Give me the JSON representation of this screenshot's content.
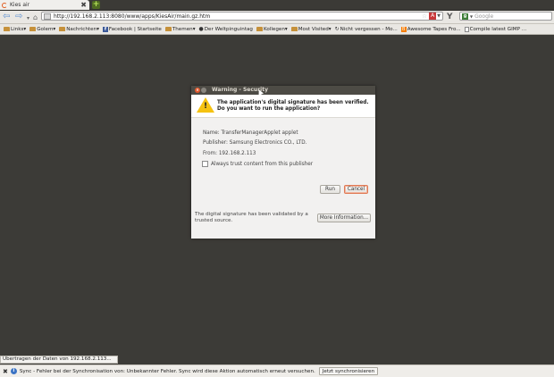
{
  "tab": {
    "title": "Kies air",
    "close_glyph": "✖"
  },
  "new_tab_glyph": "+",
  "nav": {
    "back_glyph": "⇦",
    "forward_glyph": "⇨",
    "dropdown_glyph": "▾",
    "home_glyph": "⌂",
    "url": "http://192.168.2.113:8080/www/apps/KiesAir/main.gz.htm",
    "star_glyph": "☆",
    "red_icon_glyph": "A",
    "url_dropdown_glyph": "▼",
    "twitter_glyph": "Y",
    "search_engine_glyph": "g",
    "search_dropdown_glyph": "▼",
    "search_placeholder": "Google"
  },
  "bookmarks": [
    {
      "label": "Links",
      "kind": "folder"
    },
    {
      "label": "Golem",
      "kind": "folder"
    },
    {
      "label": "Nachrichten",
      "kind": "folder"
    },
    {
      "label": "Facebook | Startseite",
      "kind": "facebook"
    },
    {
      "label": "Themen",
      "kind": "folder"
    },
    {
      "label": "Der Weltpinguintag",
      "kind": "penguin"
    },
    {
      "label": "Kollegen",
      "kind": "folder"
    },
    {
      "label": "Most Visited",
      "kind": "folder"
    },
    {
      "label": "Nicht vergessen - Mo...",
      "kind": "refresh"
    },
    {
      "label": "Awesome Tapes Fro...",
      "kind": "blogger"
    },
    {
      "label": "Compile latest GIMP ...",
      "kind": "page"
    }
  ],
  "bookmark_arrow": "▾",
  "dialog": {
    "title": "Warning - Security",
    "close_glyph": "×",
    "warning_glyph": "!",
    "heading": "The application's digital signature has been verified. Do you want to run the application?",
    "name_line": "Name:  TransferManagerApplet applet",
    "publisher_line": "Publisher: Samsung Electronics CO., LTD.",
    "from_line": "From:  192.168.2.113",
    "trust_label": "Always trust content from this publisher",
    "trust_checked": false,
    "run_label": "Run",
    "cancel_label": "Cancel",
    "footer_text": "The digital signature has been validated by a trusted source.",
    "more_info_label": "More Information..."
  },
  "status": {
    "transfer_text": "Übertragen der Daten von 192.168.2.113...",
    "notif_close_glyph": "✖",
    "notif_info_glyph": "i",
    "notification": "Sync - Fehler bei der Synchronisation von: Unbekannter Fehler. Sync wird diese Aktion automatisch erneut versuchen.",
    "sync_button": "Jetzt synchronisieren"
  },
  "colors": {
    "page_background": "#3c3b37",
    "title_bar": "#4d4b45",
    "warning": "#f5c211",
    "cancel_focus": "#e07a55"
  }
}
